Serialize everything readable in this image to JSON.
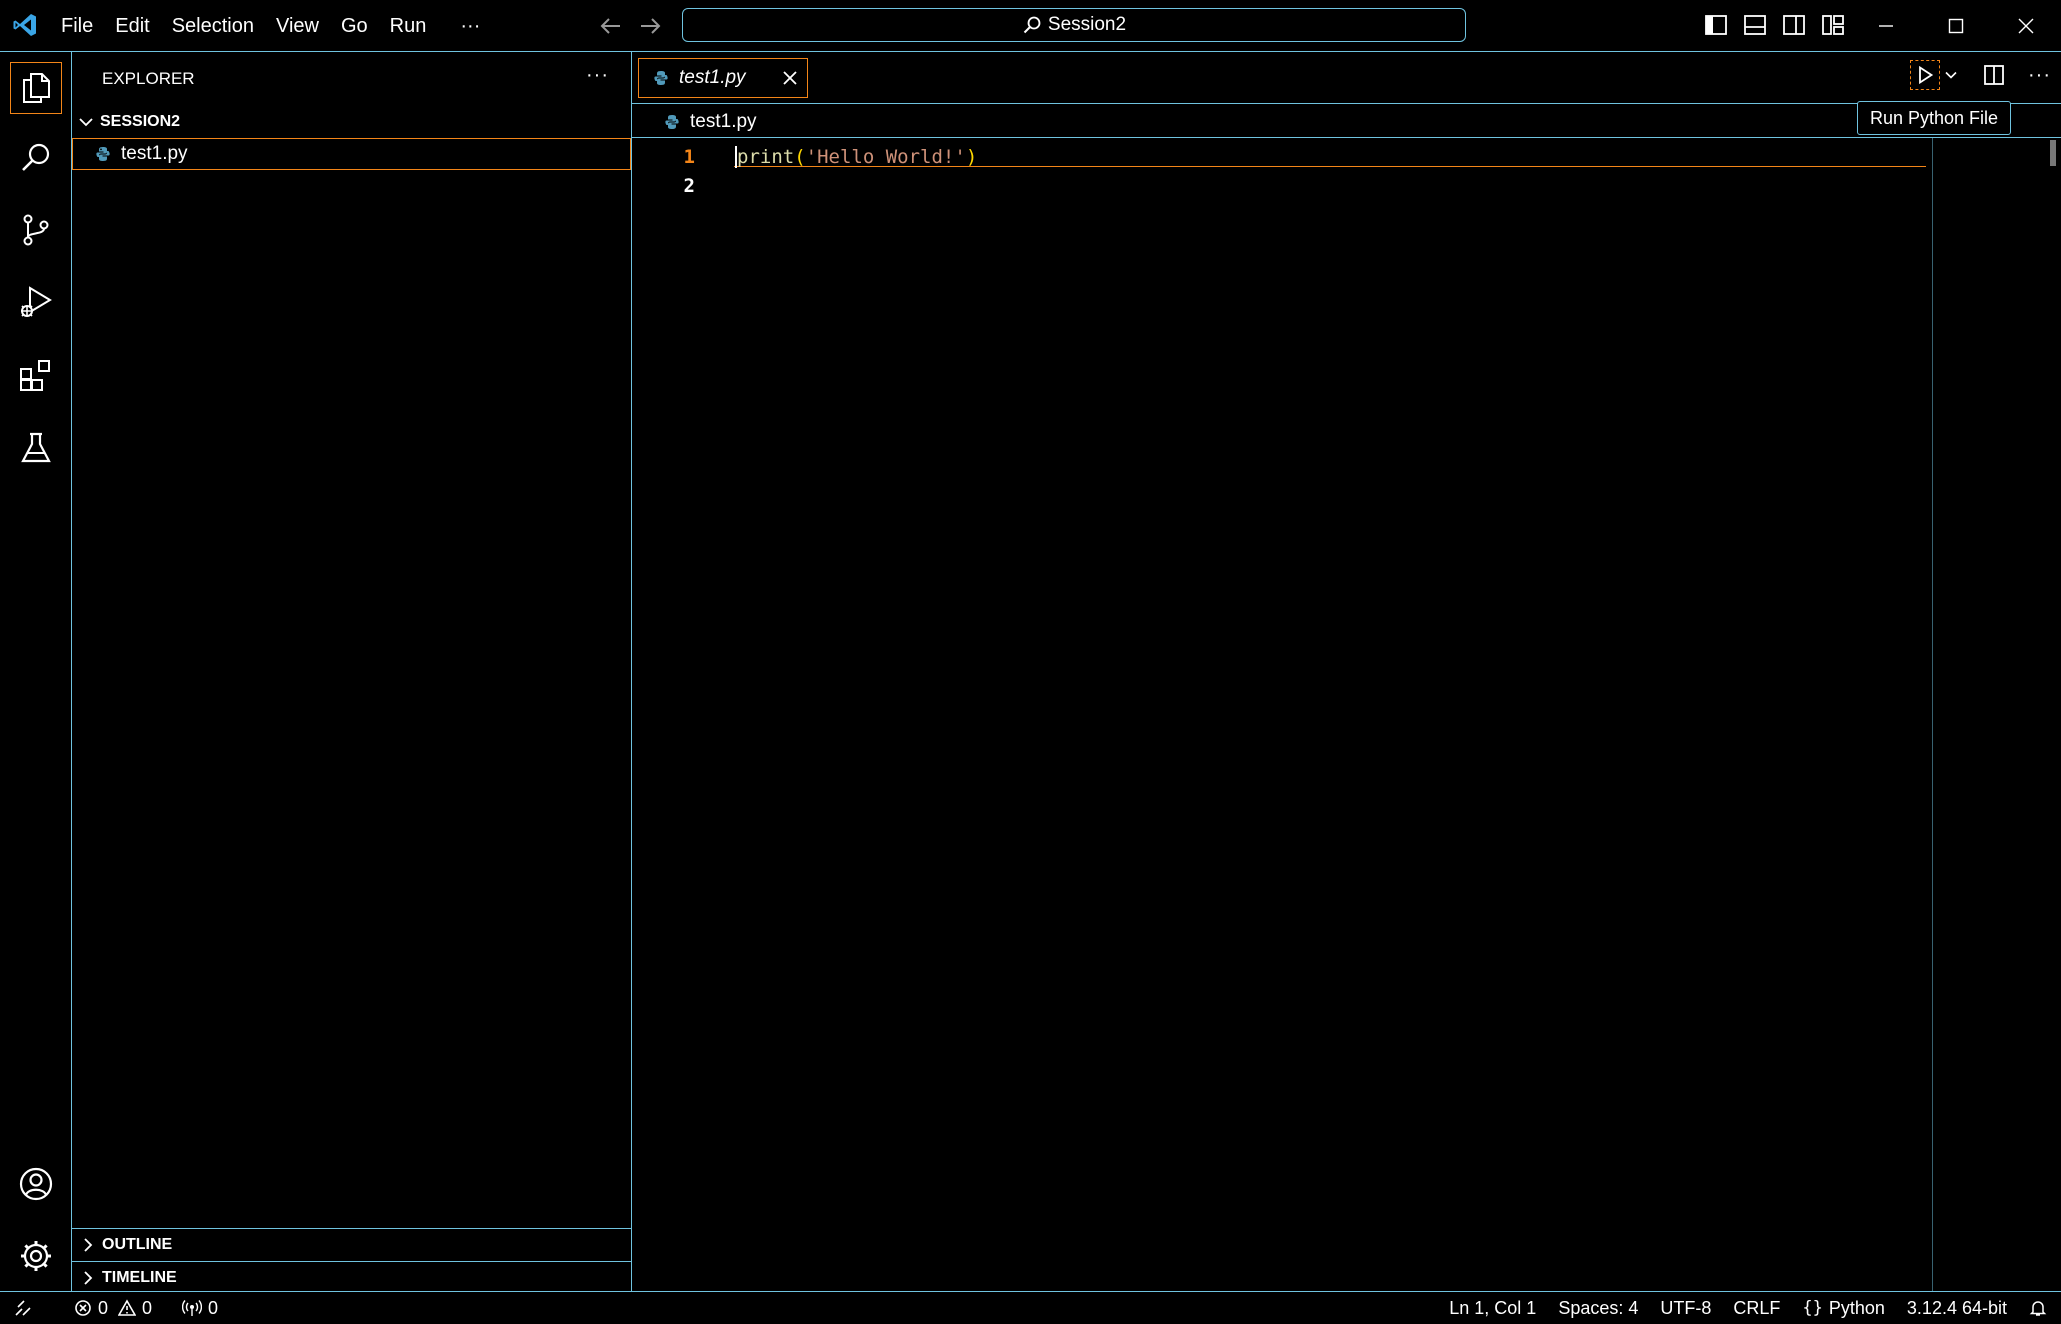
{
  "titlebar": {
    "menu": [
      "File",
      "Edit",
      "Selection",
      "View",
      "Go",
      "Run"
    ],
    "more": "···",
    "command_center": "Session2"
  },
  "sidebar": {
    "title": "EXPLORER",
    "more": "···",
    "folder": "SESSION2",
    "files": [
      {
        "name": "test1.py",
        "icon": "python-file-icon"
      }
    ],
    "outline": "OUTLINE",
    "timeline": "TIMELINE"
  },
  "editor": {
    "tab_label": "test1.py",
    "breadcrumb": "test1.py",
    "lines": [
      {
        "number": "1",
        "fn": "print",
        "open": "(",
        "str": "'Hello World!'",
        "close": ")"
      },
      {
        "number": "2"
      }
    ],
    "tooltip": "Run Python File"
  },
  "statusbar": {
    "errors": "0",
    "warnings": "0",
    "ports": "0",
    "position": "Ln 1, Col 1",
    "spaces": "Spaces: 4",
    "encoding": "UTF-8",
    "eol": "CRLF",
    "language": "Python",
    "interpreter": "3.12.4 64-bit"
  },
  "colors": {
    "border": "#6fc3df",
    "active": "#f38518",
    "string": "#ce9178",
    "function": "#dcdcaa",
    "bracket": "#ffd700",
    "python": "#519aba"
  }
}
